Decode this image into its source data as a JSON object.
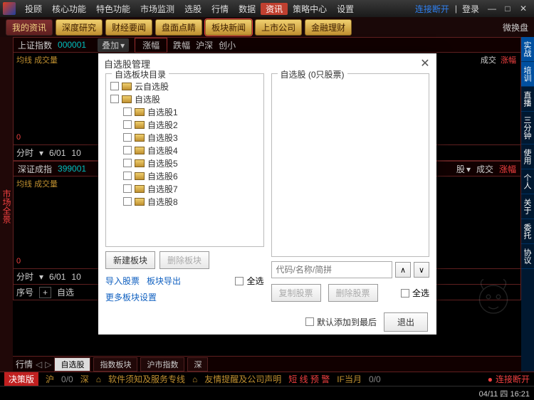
{
  "titlebar": {
    "menu": [
      "投顾",
      "核心功能",
      "特色功能",
      "市场监测",
      "选股",
      "行情",
      "数据",
      "资讯",
      "策略中心",
      "设置"
    ],
    "active_index": 7,
    "link_status": "连接断开",
    "login": "登录"
  },
  "toolbar2": {
    "buttons": [
      {
        "label": "我的资讯",
        "dark": true
      },
      {
        "label": "深度研究"
      },
      {
        "label": "财经要闻"
      },
      {
        "label": "盘面点睛"
      },
      {
        "label": "板块新闻",
        "hl": true
      },
      {
        "label": "上市公司"
      },
      {
        "label": "金融理财"
      }
    ],
    "mini": "微换盘"
  },
  "left_strip": "市场全景",
  "right_strip": [
    "实战",
    "培训",
    "直播",
    "三分钟",
    "使用",
    "个人",
    "关于",
    "委托",
    "协议"
  ],
  "indexes": [
    {
      "name": "上证指数",
      "code": "000001",
      "avg": "均线",
      "vol": "成交量",
      "time": "分时",
      "date": "6/01",
      "val": "10"
    },
    {
      "name": "深证成指",
      "code": "399001",
      "avg": "均线",
      "vol": "成交量",
      "time": "分时",
      "date": "6/01",
      "val": "10"
    }
  ],
  "top_tabs": {
    "add": "叠加",
    "items": [
      "涨幅",
      "跌幅",
      "沪深",
      "创小"
    ],
    "right": [
      "成交",
      "涨幅"
    ]
  },
  "seq_row": {
    "seq": "序号",
    "plus": "+",
    "sel": "自选"
  },
  "bottom_tabs": {
    "label": "行情",
    "items": [
      "自选股",
      "指数板块",
      "沪市指数",
      "深"
    ],
    "active": 0
  },
  "statusbar": {
    "version": "决策版",
    "hu": "沪",
    "shen": "深",
    "ratio1": "0/0",
    "ratio2": "0/0",
    "notice": "软件须知及服务专线",
    "remind": "友情提醒及公司声明",
    "warn": "短 线 预 警",
    "if": "IF当月",
    "link": "连接断开",
    "date": "04/11 四 16:21"
  },
  "dialog": {
    "title": "自选股管理",
    "left_legend": "自选板块目录",
    "right_legend": "自选股 (0只股票)",
    "tree": [
      {
        "label": "云自选股",
        "child": false
      },
      {
        "label": "自选股",
        "child": false
      },
      {
        "label": "自选股1",
        "child": true
      },
      {
        "label": "自选股2",
        "child": true
      },
      {
        "label": "自选股3",
        "child": true
      },
      {
        "label": "自选股4",
        "child": true
      },
      {
        "label": "自选股5",
        "child": true
      },
      {
        "label": "自选股6",
        "child": true
      },
      {
        "label": "自选股7",
        "child": true
      },
      {
        "label": "自选股8",
        "child": true
      }
    ],
    "new_block": "新建板块",
    "del_block": "删除板块",
    "import": "导入股票",
    "export": "板块导出",
    "select_all": "全选",
    "more": "更多板块设置",
    "search_placeholder": "代码/名称/简拼",
    "up": "∧",
    "down": "∨",
    "copy": "复制股票",
    "del_stock": "删除股票",
    "append_last": "默认添加到最后",
    "exit": "退出"
  }
}
